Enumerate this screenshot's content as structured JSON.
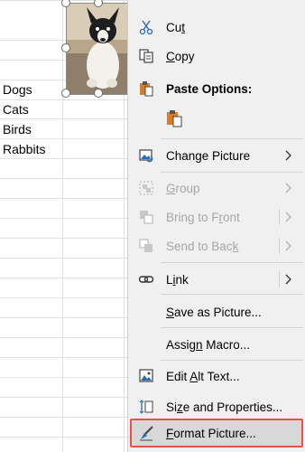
{
  "sheet": {
    "cells": [
      "Dogs",
      "Cats",
      "Birds",
      "Rabbits"
    ]
  },
  "menu": {
    "cut": {
      "pre": "Cu",
      "acc": "t",
      "post": ""
    },
    "copy": {
      "pre": "",
      "acc": "C",
      "post": "opy"
    },
    "paste_options": "Paste Options:",
    "change_picture": {
      "pre": "Chan",
      "acc": "g",
      "post": "e Picture"
    },
    "group": {
      "pre": "",
      "acc": "G",
      "post": "roup"
    },
    "bring_to_front": {
      "pre": "Bring to F",
      "acc": "r",
      "post": "ont"
    },
    "send_to_back": {
      "pre": "Send to Bac",
      "acc": "k",
      "post": ""
    },
    "link": {
      "pre": "L",
      "acc": "i",
      "post": "nk"
    },
    "save_as_picture": {
      "pre": "",
      "acc": "S",
      "post": "ave as Picture..."
    },
    "assign_macro": {
      "pre": "Assig",
      "acc": "n",
      "post": " Macro..."
    },
    "edit_alt_text": {
      "pre": "Edit ",
      "acc": "A",
      "post": "lt Text..."
    },
    "size_properties": {
      "pre": "Si",
      "acc": "z",
      "post": "e and Properties..."
    },
    "format_picture": {
      "pre": "",
      "acc": "F",
      "post": "ormat Picture..."
    }
  },
  "colors": {
    "menu_bg": "#f0f0f0",
    "highlight_border": "#e8504a",
    "disabled_text": "#a6a6a6",
    "accent_blue": "#2b6cb0",
    "accent_orange": "#e07b1f"
  }
}
